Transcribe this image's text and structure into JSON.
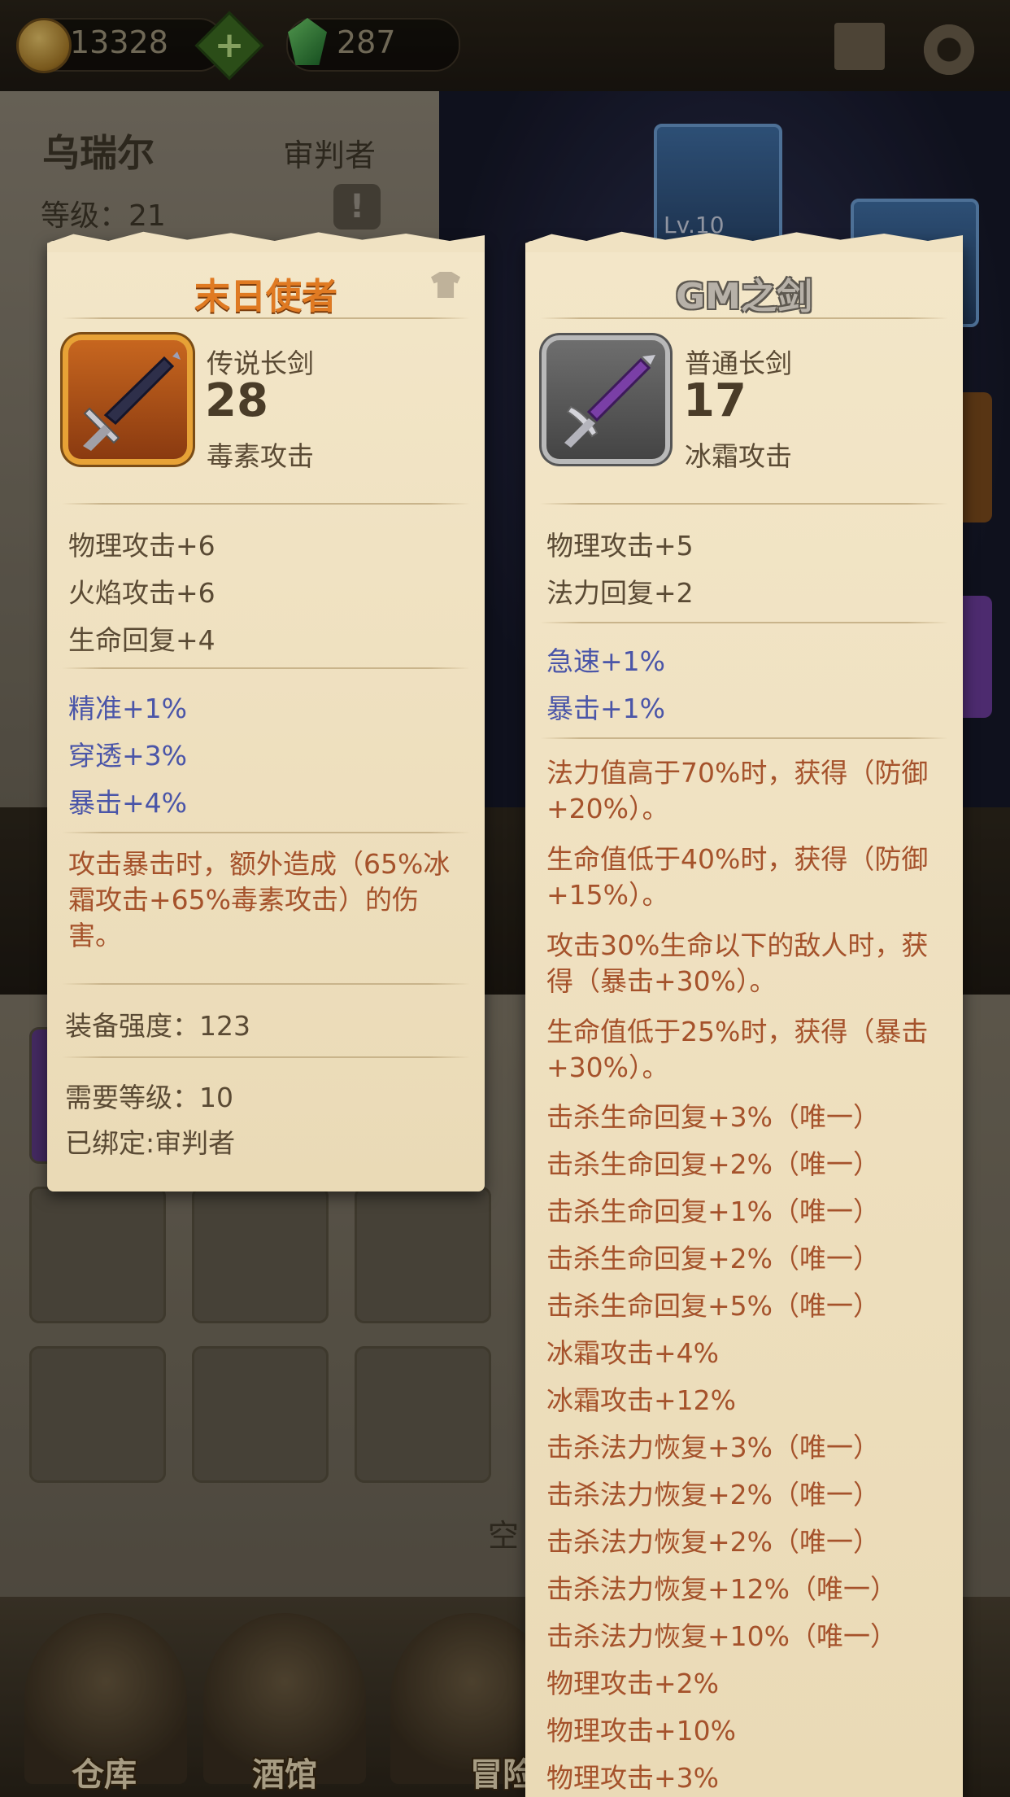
{
  "topbar": {
    "gold": "13328",
    "gems": "287"
  },
  "hero": {
    "name": "乌瑞尔",
    "class": "审判者",
    "level": "等级：21"
  },
  "scene_slots": {
    "slot_level": "Lv.10"
  },
  "inventory": {
    "empty_label": "空"
  },
  "nav": {
    "warehouse": "仓库",
    "tavern": "酒馆",
    "adventure": "冒险"
  },
  "card_left": {
    "title": "末日使者",
    "item_type": "传说长剑",
    "item_power": "28",
    "damage_type": "毒素攻击",
    "base_stats": [
      "物理攻击+6",
      "火焰攻击+6",
      "生命回复+4"
    ],
    "bonus_stats": [
      "精准+1%",
      "穿透+3%",
      "暴击+4%"
    ],
    "special": "攻击暴击时，额外造成（65%冰霜攻击+65%毒素攻击）的伤害。",
    "gear_score": "装备强度：123",
    "required_level": "需要等级：10",
    "bound": "已绑定:审判者"
  },
  "card_right": {
    "title": "GM之剑",
    "item_type": "普通长剑",
    "item_power": "17",
    "damage_type": "冰霜攻击",
    "base_stats": [
      "物理攻击+5",
      "法力回复+2"
    ],
    "bonus_stats": [
      "急速+1%",
      "暴击+1%"
    ],
    "effects": [
      "法力值高于70%时，获得（防御+20%）。",
      "生命值低于40%时，获得（防御+15%）。",
      "攻击30%生命以下的敌人时，获得（暴击+30%）。",
      "生命值低于25%时，获得（暴击+30%）。",
      "击杀生命回复+3%（唯一）",
      "击杀生命回复+2%（唯一）",
      "击杀生命回复+1%（唯一）",
      "击杀生命回复+2%（唯一）",
      "击杀生命回复+5%（唯一）",
      "冰霜攻击+4%",
      "冰霜攻击+12%",
      "击杀法力恢复+3%（唯一）",
      "击杀法力恢复+2%（唯一）",
      "击杀法力恢复+2%（唯一）",
      "击杀法力恢复+12%（唯一）",
      "击杀法力恢复+10%（唯一）",
      "物理攻击+2%",
      "物理攻击+10%",
      "物理攻击+3%"
    ]
  },
  "colors": {
    "title_orange": "#e07a22",
    "stat_blue": "#4a55a8",
    "effect_brown": "#a5522b",
    "parchment": "#f0e2c2"
  },
  "icons": [
    "gold-coin-icon",
    "add-icon",
    "gem-icon",
    "book-icon",
    "settings-gear-icon",
    "alert-icon",
    "shirt-icon",
    "sword-icon"
  ]
}
